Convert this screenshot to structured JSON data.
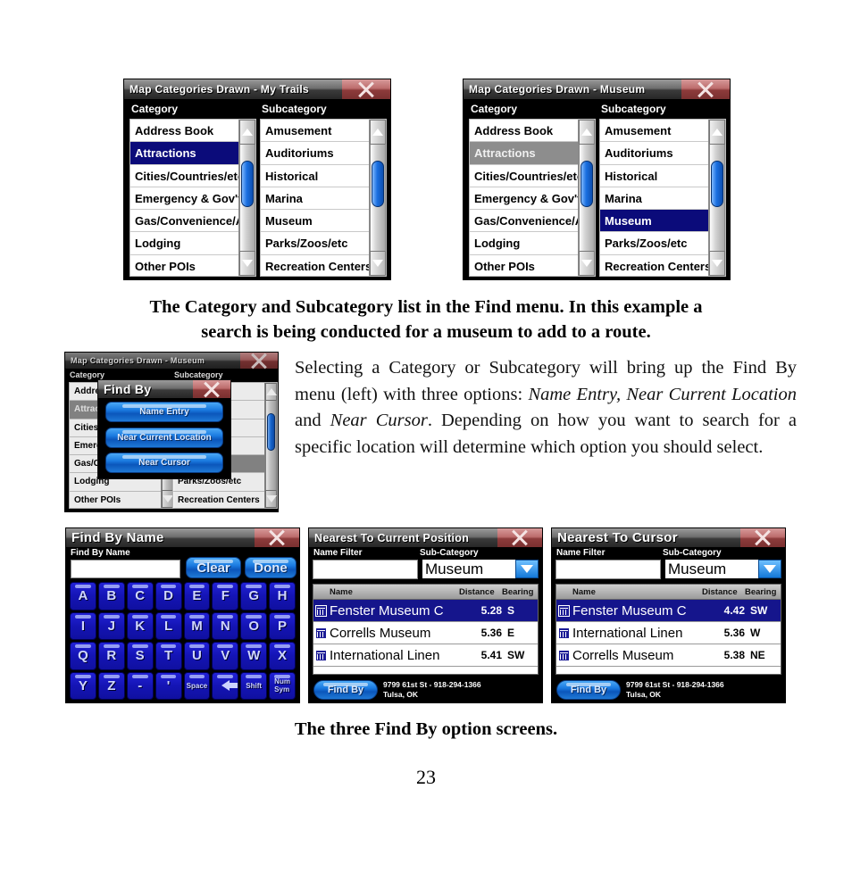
{
  "page": {
    "number": "23"
  },
  "colors": {
    "select_blue": "#0b0b7a",
    "select_gray": "#8d8d8d",
    "button_blue": "#1a7ae0",
    "close_red": "#bd6d6d",
    "key_blue": "#1414b4"
  },
  "panel_my_trails": {
    "title": "Map Categories Drawn - My Trails",
    "close_icon": "close-x-icon",
    "category_label": "Category",
    "subcategory_label": "Subcategory",
    "categories": [
      "Address Book",
      "Attractions",
      "Cities/Countries/etc",
      "Emergency & Gov't",
      "Gas/Convenience/AT",
      "Lodging",
      "Other POIs"
    ],
    "category_selected": "Attractions",
    "category_selected_style": "blue",
    "subcategories": [
      "Amusement",
      "Auditoriums",
      "Historical",
      "Marina",
      "Museum",
      "Parks/Zoos/etc",
      "Recreation Centers"
    ],
    "subcategory_selected": "",
    "scroll_up_icon": "scroll-up-arrow-icon",
    "scroll_down_icon": "scroll-down-arrow-icon"
  },
  "panel_museum": {
    "title": "Map Categories Drawn - Museum",
    "close_icon": "close-x-icon",
    "category_label": "Category",
    "subcategory_label": "Subcategory",
    "categories": [
      "Address Book",
      "Attractions",
      "Cities/Countries/etc",
      "Emergency & Gov't",
      "Gas/Convenience/AT",
      "Lodging",
      "Other POIs"
    ],
    "category_selected": "Attractions",
    "category_selected_style": "gray",
    "subcategories": [
      "Amusement",
      "Auditoriums",
      "Historical",
      "Marina",
      "Museum",
      "Parks/Zoos/etc",
      "Recreation Centers"
    ],
    "subcategory_selected": "Museum",
    "scroll_up_icon": "scroll-up-arrow-icon",
    "scroll_down_icon": "scroll-down-arrow-icon"
  },
  "caption_top": {
    "line1": "The Category and Subcategory list in the Find menu. In this example a",
    "line2": "search is being conducted for a museum to add to a route."
  },
  "panel_findby": {
    "background_title": "Map Categories Drawn - Museum",
    "background_category_label": "Category",
    "background_subcategory_label": "Subcategory",
    "background_categories": [
      "Address",
      "Attractio",
      "Cities/Co",
      "Emergenc",
      "Gas/Conv",
      "Lodging",
      "Other POIs"
    ],
    "background_category_selected": "Attractio",
    "background_subcategories_visible": [
      "Parks/Zoos/etc",
      "Recreation Centers"
    ],
    "dialog_title": "Find By",
    "dialog_close_icon": "close-x-icon",
    "options": [
      "Name Entry",
      "Near Current Location",
      "Near Cursor"
    ]
  },
  "body_paragraph": {
    "segments": [
      {
        "text": "Selecting a Category or Subcategory will bring up the Find By menu (left) with three options: ",
        "style": "normal"
      },
      {
        "text": "Name Entry, Near Current Location",
        "style": "italic"
      },
      {
        "text": " and ",
        "style": "normal"
      },
      {
        "text": "Near Cursor",
        "style": "italic"
      },
      {
        "text": ". Depending on how you want to search for a specific location will determine which option you should select.",
        "style": "normal"
      }
    ]
  },
  "panel_find_by_name": {
    "title": "Find By Name",
    "close_icon": "close-x-icon",
    "field_label": "Find By Name",
    "field_value": "",
    "clear_label": "Clear",
    "done_label": "Done",
    "keys_row1": [
      "A",
      "B",
      "C",
      "D",
      "E",
      "F",
      "G",
      "H"
    ],
    "keys_row2": [
      "I",
      "J",
      "K",
      "L",
      "M",
      "N",
      "O",
      "P"
    ],
    "keys_row3": [
      "Q",
      "R",
      "S",
      "T",
      "U",
      "V",
      "W",
      "X"
    ],
    "keys_row4": [
      "Y",
      "Z",
      "-",
      "'",
      "Space",
      "backspace-arrow-icon",
      "Shift",
      "Num Sym"
    ]
  },
  "panel_nearest_current": {
    "title": "Nearest To Current Position",
    "close_icon": "close-x-icon",
    "name_filter_label": "Name Filter",
    "name_filter_value": "",
    "subcategory_label": "Sub-Category",
    "subcategory_value": "Museum",
    "dropdown_icon": "chevron-down-icon",
    "columns": [
      "Name",
      "Distance",
      "Bearing"
    ],
    "rows": [
      {
        "icon": "museum-poi-icon",
        "name": "Fenster Museum C",
        "distance": "5.28",
        "bearing": "S",
        "selected": true
      },
      {
        "icon": "museum-poi-icon",
        "name": "Corrells Museum",
        "distance": "5.36",
        "bearing": "E",
        "selected": false
      },
      {
        "icon": "museum-poi-icon",
        "name": "International Linen",
        "distance": "5.41",
        "bearing": "SW",
        "selected": false
      }
    ],
    "find_by_label": "Find By",
    "address_line1": "9799 61st St - 918-294-1366",
    "address_line2": "Tulsa, OK"
  },
  "panel_nearest_cursor": {
    "title": "Nearest To Cursor",
    "close_icon": "close-x-icon",
    "name_filter_label": "Name Filter",
    "name_filter_value": "",
    "subcategory_label": "Sub-Category",
    "subcategory_value": "Museum",
    "dropdown_icon": "chevron-down-icon",
    "columns": [
      "Name",
      "Distance",
      "Bearing"
    ],
    "rows": [
      {
        "icon": "museum-poi-icon",
        "name": "Fenster Museum C",
        "distance": "4.42",
        "bearing": "SW",
        "selected": true
      },
      {
        "icon": "museum-poi-icon",
        "name": "International Linen",
        "distance": "5.36",
        "bearing": "W",
        "selected": false
      },
      {
        "icon": "museum-poi-icon",
        "name": "Corrells Museum",
        "distance": "5.38",
        "bearing": "NE",
        "selected": false
      }
    ],
    "find_by_label": "Find By",
    "address_line1": "9799 61st St - 918-294-1366",
    "address_line2": "Tulsa, OK"
  },
  "caption_bottom": {
    "line1": "The three Find By option screens."
  }
}
